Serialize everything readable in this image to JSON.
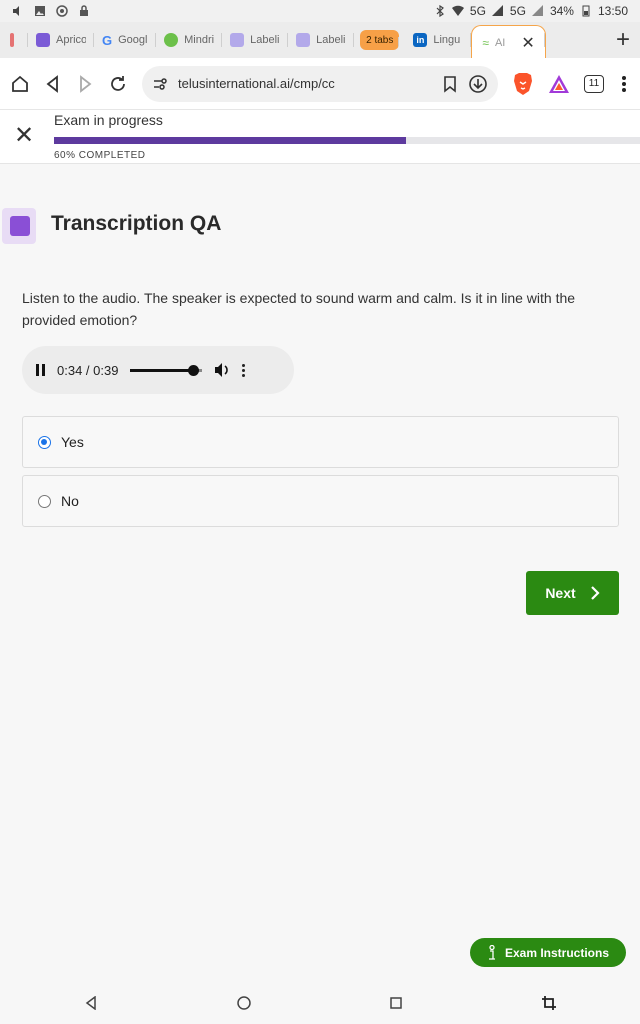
{
  "status_bar": {
    "network": "5G",
    "network2": "5G",
    "battery": "34%",
    "time": "13:50"
  },
  "tabs": [
    {
      "label": "Aprico",
      "favicon": "list-icon",
      "color": "#7b5bd6"
    },
    {
      "label": "Googl",
      "favicon": "google-icon",
      "color": "#4285f4"
    },
    {
      "label": "Mindri",
      "favicon": "mindrift-icon",
      "color": "#6cc04a"
    },
    {
      "label": "Labeli",
      "favicon": "labelbox-icon",
      "color": "#9b8fe0"
    },
    {
      "label": "Labeli",
      "favicon": "labelbox-icon",
      "color": "#9b8fe0"
    },
    {
      "label": "2 tabs",
      "group": true
    },
    {
      "label": "Lingu",
      "favicon": "linkedin-icon",
      "color": "#0a66c2"
    },
    {
      "label": "AI",
      "favicon": "telus-icon",
      "color": "#6cc04a",
      "active": true
    }
  ],
  "browser": {
    "url": "telusinternational.ai/cmp/cc",
    "tab_count": "11"
  },
  "exam": {
    "header_title": "Exam in progress",
    "progress_value": 0.6,
    "progress_label": "60% COMPLETED",
    "accent": "#5d3a9e"
  },
  "section": {
    "title": "Transcription QA"
  },
  "question": {
    "text": "Listen to the audio. The speaker is expected to sound warm and calm. Is it in line with the provided emotion?"
  },
  "audio": {
    "time_display": "0:34 / 0:39",
    "played_fraction": 0.87
  },
  "options": [
    {
      "label": "Yes",
      "selected": true
    },
    {
      "label": "No",
      "selected": false
    }
  ],
  "actions": {
    "next_label": "Next",
    "instructions_label": "Exam Instructions",
    "button_color": "#2b8a12"
  }
}
